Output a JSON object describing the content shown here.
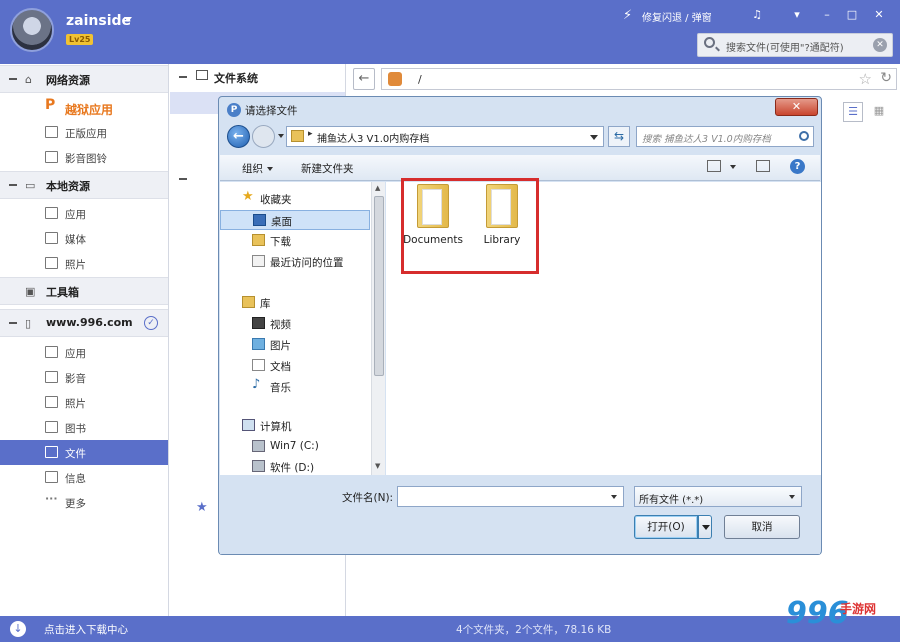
{
  "app": {
    "username": "zainside",
    "level": "Lv25",
    "fix_link": "修复闪退 / 弹窗",
    "search_placeholder": "搜索文件(可使用\"?通配符)"
  },
  "sidebar": {
    "net_title": "网络资源",
    "net_items": [
      {
        "label": "越狱应用",
        "icon": "jailbreak-icon"
      },
      {
        "label": "正版应用",
        "icon": "app-icon"
      },
      {
        "label": "影音图铃",
        "icon": "music-icon"
      }
    ],
    "local_title": "本地资源",
    "local_items": [
      {
        "label": "应用",
        "icon": "grid-icon"
      },
      {
        "label": "媒体",
        "icon": "video-icon"
      },
      {
        "label": "照片",
        "icon": "photo-icon"
      }
    ],
    "toolbox_title": "工具箱",
    "device_title": "www.996.com",
    "device_items": [
      {
        "label": "应用"
      },
      {
        "label": "影音"
      },
      {
        "label": "照片"
      },
      {
        "label": "图书"
      },
      {
        "label": "文件"
      },
      {
        "label": "信息"
      },
      {
        "label": "更多"
      }
    ]
  },
  "middle": {
    "title": "文件系统"
  },
  "main": {
    "path": "/"
  },
  "status": {
    "left": "点击进入下载中心",
    "center": "4个文件夹，2个文件，78.16 KB",
    "logo": "996",
    "logo_suffix": "手游网"
  },
  "dialog": {
    "title": "请选择文件",
    "close": "✕",
    "address": "捕鱼达人3 V1.0内购存档",
    "search_placeholder": "搜索 捕鱼达人3 V1.0内购存档",
    "organize": "组织",
    "new_folder": "新建文件夹",
    "nav_favorites": "收藏夹",
    "nav_items": [
      {
        "label": "桌面"
      },
      {
        "label": "下载"
      },
      {
        "label": "最近访问的位置"
      }
    ],
    "nav_library": "库",
    "library_items": [
      {
        "label": "视频"
      },
      {
        "label": "图片"
      },
      {
        "label": "文档"
      },
      {
        "label": "音乐"
      }
    ],
    "nav_computer": "计算机",
    "computer_items": [
      {
        "label": "Win7 (C:)"
      },
      {
        "label": "软件 (D:)"
      }
    ],
    "folders": [
      {
        "name": "Documents"
      },
      {
        "name": "Library"
      }
    ],
    "filename_label": "文件名(N):",
    "filename_value": "",
    "filter": "所有文件 (*.*)",
    "open": "打开(O)",
    "cancel": "取消"
  },
  "colors": {
    "brand": "#5a6fc9",
    "highlight": "#d62d2d"
  }
}
